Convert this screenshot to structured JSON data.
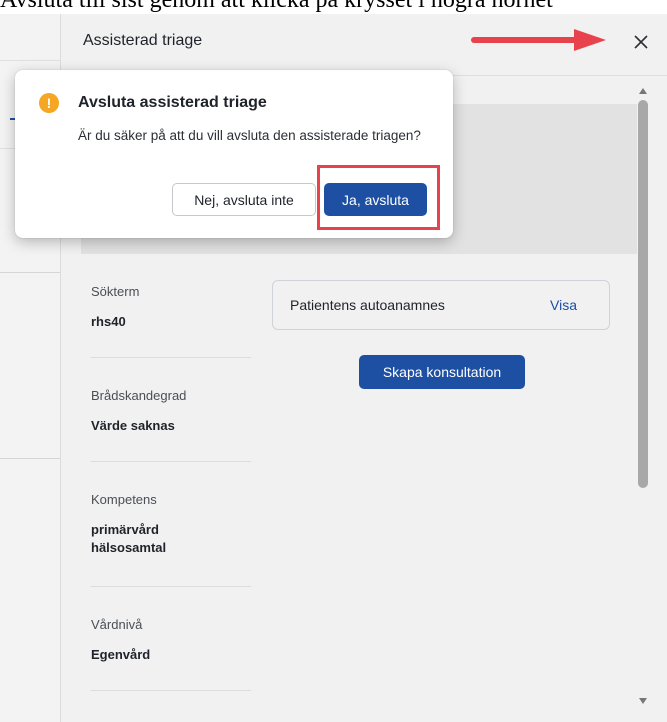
{
  "caption": "Avsluta till sist genom att klicka på krysset i högra hörnet",
  "panel": {
    "title": "Assisterad triage"
  },
  "facts": [
    {
      "label": "Sökterm",
      "value": "rhs40"
    },
    {
      "label": "Brådskandegrad",
      "value": "Värde saknas"
    },
    {
      "label": "Kompetens",
      "value": "primärvård\nhälsosamtal"
    },
    {
      "label": "Vårdnivå",
      "value": "Egenvård"
    }
  ],
  "anamnes": {
    "label": "Patientens autoanamnes",
    "link": "Visa"
  },
  "consult_button": "Skapa konsultation",
  "dialog": {
    "title": "Avsluta assisterad triage",
    "body": "Är du säker på att du vill avsluta den assisterade triagen?",
    "cancel_label": "Nej, avsluta inte",
    "confirm_label": "Ja, avsluta"
  },
  "colors": {
    "primary": "#1d4fa3",
    "warning": "#f5a623",
    "annotation": "#e8434d"
  },
  "icons": {
    "close": "close-icon",
    "warning": "warning-icon",
    "arrow": "arrow-right-icon"
  }
}
